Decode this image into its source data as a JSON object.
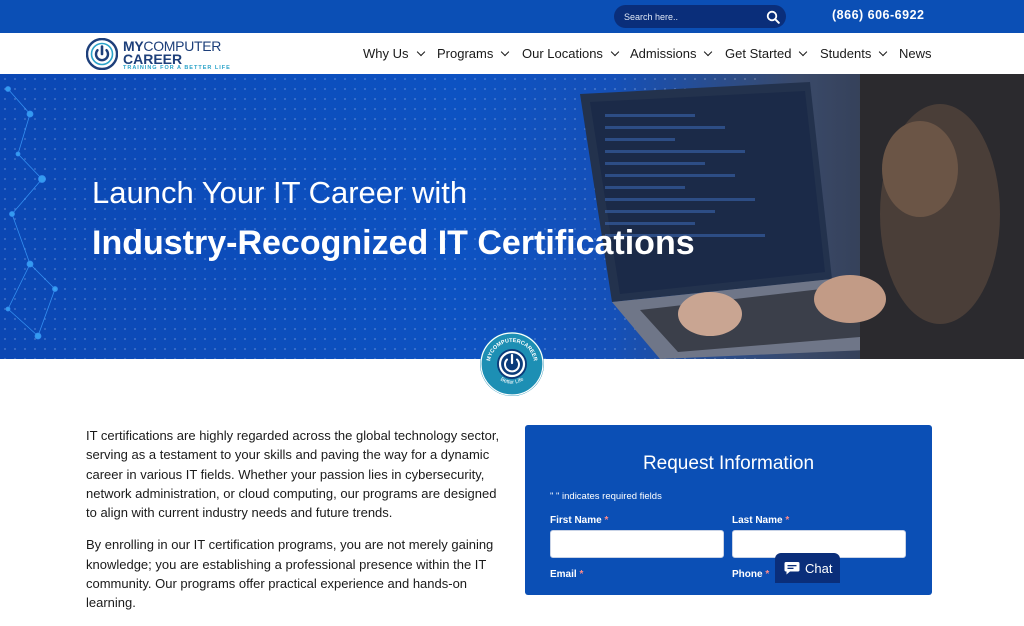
{
  "topbar": {
    "search_placeholder": "Search here..",
    "phone": "(866) 606-6922"
  },
  "logo": {
    "line1_bold": "MY",
    "line1_rest": "COMPUTER",
    "line2": "CAREER",
    "tagline": "TRAINING FOR A BETTER LIFE"
  },
  "nav": {
    "items": [
      {
        "label": "Why Us",
        "dropdown": true
      },
      {
        "label": "Programs",
        "dropdown": true
      },
      {
        "label": "Our Locations",
        "dropdown": true
      },
      {
        "label": "Admissions",
        "dropdown": true
      },
      {
        "label": "Get Started",
        "dropdown": true
      },
      {
        "label": "Students",
        "dropdown": true
      },
      {
        "label": "News",
        "dropdown": false
      }
    ]
  },
  "hero": {
    "line1": "Launch Your IT Career with",
    "line2": "Industry-Recognized IT Certifications"
  },
  "badge": {
    "top_text": "MYCOMPUTERCAREER",
    "bottom_text": "Better Life"
  },
  "content": {
    "paragraphs": [
      "IT certifications are highly regarded across the global technology sector, serving as a testament to your skills and paving the way for a dynamic career in various IT fields. Whether your passion lies in cybersecurity, network administration, or cloud computing, our programs are designed to align with current industry needs and future trends.",
      "By enrolling in our IT certification programs, you are not merely gaining knowledge; you are establishing a professional presence within the IT community. Our programs offer practical experience and hands-on learning."
    ]
  },
  "form": {
    "title": "Request Information",
    "required_note": "\" \" indicates required fields",
    "first_name_label": "First Name",
    "last_name_label": "Last Name",
    "email_label": "Email",
    "phone_label": "Phone",
    "required_marker": "*"
  },
  "chat": {
    "label": "Chat"
  },
  "colors": {
    "brand_blue": "#0b4fb5",
    "dark_blue": "#0a2e7a",
    "logo_navy": "#1d3f7a",
    "accent_teal": "#2aa3c9"
  }
}
